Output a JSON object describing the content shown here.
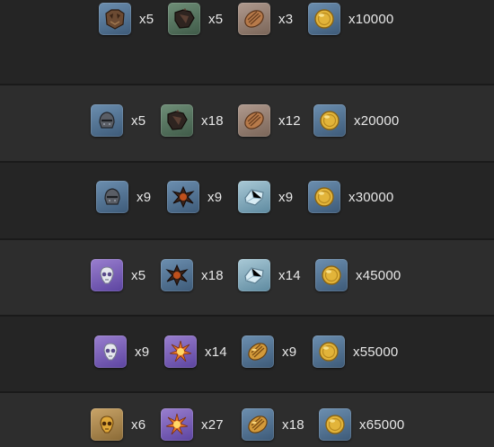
{
  "rows": [
    {
      "items": [
        {
          "icon": "fur-pelt-icon",
          "tile": "blue",
          "qty": "x5"
        },
        {
          "icon": "dark-leather-icon",
          "tile": "green",
          "qty": "x5"
        },
        {
          "icon": "wood-plank-icon",
          "tile": "tan",
          "qty": "x3"
        },
        {
          "icon": "gold-coin-icon",
          "tile": "blue",
          "qty": "x10000"
        }
      ]
    },
    {
      "items": [
        {
          "icon": "iron-helmet-icon",
          "tile": "blue",
          "qty": "x5"
        },
        {
          "icon": "dark-leather-icon",
          "tile": "green",
          "qty": "x18"
        },
        {
          "icon": "wood-plank-icon",
          "tile": "tan",
          "qty": "x12"
        },
        {
          "icon": "gold-coin-icon",
          "tile": "blue",
          "qty": "x20000"
        }
      ]
    },
    {
      "items": [
        {
          "icon": "iron-helmet-icon",
          "tile": "blue",
          "qty": "x9"
        },
        {
          "icon": "spiked-hide-icon",
          "tile": "blue",
          "qty": "x9"
        },
        {
          "icon": "crystal-bar-icon",
          "tile": "ice",
          "qty": "x9"
        },
        {
          "icon": "gold-coin-icon",
          "tile": "blue",
          "qty": "x30000"
        }
      ]
    },
    {
      "items": [
        {
          "icon": "skull-mask-icon",
          "tile": "purple",
          "qty": "x5"
        },
        {
          "icon": "spiked-hide-icon",
          "tile": "blue",
          "qty": "x18"
        },
        {
          "icon": "crystal-bar-icon",
          "tile": "ice",
          "qty": "x14"
        },
        {
          "icon": "gold-coin-icon",
          "tile": "blue",
          "qty": "x45000"
        }
      ]
    },
    {
      "items": [
        {
          "icon": "skull-mask-icon",
          "tile": "purple",
          "qty": "x9"
        },
        {
          "icon": "fire-burst-icon",
          "tile": "purple",
          "qty": "x14"
        },
        {
          "icon": "golden-log-icon",
          "tile": "blue",
          "qty": "x9"
        },
        {
          "icon": "gold-coin-icon",
          "tile": "blue",
          "qty": "x55000"
        }
      ]
    },
    {
      "items": [
        {
          "icon": "golden-skull-icon",
          "tile": "gold",
          "qty": "x6"
        },
        {
          "icon": "fire-burst-icon",
          "tile": "purple",
          "qty": "x27"
        },
        {
          "icon": "golden-log-icon",
          "tile": "blue",
          "qty": "x18"
        },
        {
          "icon": "gold-coin-icon",
          "tile": "blue",
          "qty": "x65000"
        }
      ]
    }
  ]
}
